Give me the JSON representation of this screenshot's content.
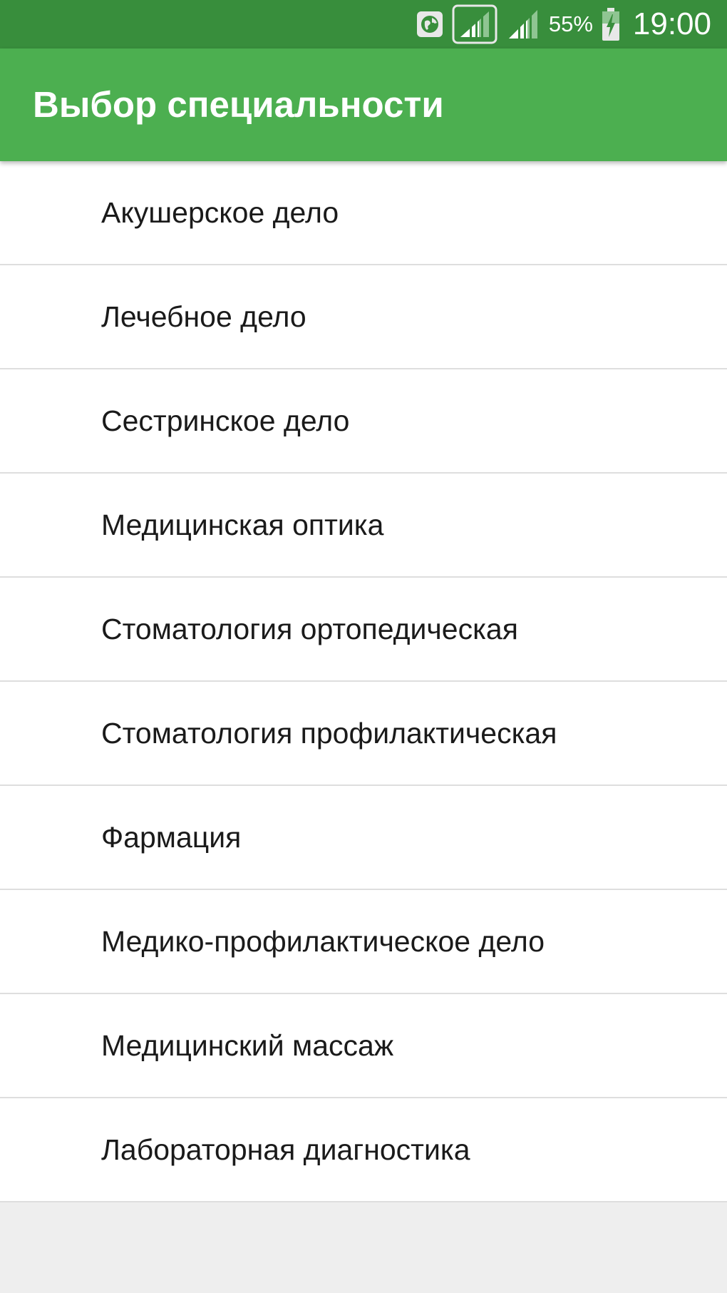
{
  "status_bar": {
    "icons": [
      "globe-icon",
      "signal-icon-sim1",
      "signal-icon-sim2",
      "battery-charging-icon"
    ],
    "battery_percent": "55%",
    "time": "19:00"
  },
  "app_bar": {
    "title": "Выбор специальности",
    "color": "#4caf50",
    "status_color": "#388e3c"
  },
  "specialties": [
    {
      "label": "Акушерское дело"
    },
    {
      "label": "Лечебное дело"
    },
    {
      "label": "Сестринское дело"
    },
    {
      "label": "Медицинская оптика"
    },
    {
      "label": "Стоматология ортопедическая"
    },
    {
      "label": "Стоматология профилактическая"
    },
    {
      "label": "Фармация"
    },
    {
      "label": "Медико-профилактическое дело"
    },
    {
      "label": "Медицинский массаж"
    },
    {
      "label": "Лабораторная диагностика"
    }
  ]
}
